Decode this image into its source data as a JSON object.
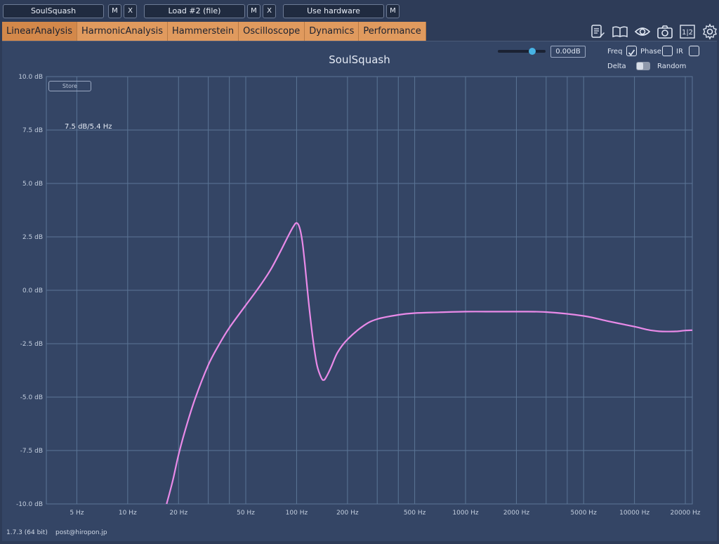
{
  "header": {
    "plugin_slot": "SoulSquash",
    "load_slot": "Load #2 (file)",
    "hardware_slot": "Use hardware",
    "m_label": "M",
    "x_label": "X"
  },
  "tabs": [
    "LinearAnalysis",
    "HarmonicAnalysis",
    "Hammerstein",
    "Oscilloscope",
    "Dynamics",
    "Performance"
  ],
  "toolbar_icons": [
    "notes-icon",
    "book-icon",
    "eye-icon",
    "camera-icon",
    "one-two-icon",
    "gear-icon"
  ],
  "one_two_label": "1|2",
  "plot": {
    "title": "SoulSquash",
    "gain_value": "0.00dB",
    "gain_level": 0.72,
    "freq_label": "Freq",
    "phase_label": "Phase",
    "ir_label": "IR",
    "delta_label": "Delta",
    "random_label": "Random",
    "freq_checked": true,
    "phase_checked": false,
    "ir_checked": false,
    "store_label": "Store",
    "cursor_readout": "7.5 dB/5.4 Hz"
  },
  "footer": {
    "version": "1.7.3 (64 bit)",
    "email": "post@hiropon.jp"
  },
  "colors": {
    "background": "#344565",
    "grid": "#5b7596",
    "curve": "#e98ae8",
    "tab": "#e09a5e"
  },
  "chart_data": {
    "type": "line",
    "title": "SoulSquash",
    "x_scale": "log",
    "xlim": [
      3.3,
      22000
    ],
    "ylim": [
      -10,
      10
    ],
    "y_ticks": [
      10,
      7.5,
      5,
      2.5,
      0,
      -2.5,
      -5,
      -7.5,
      -10
    ],
    "y_tick_labels": [
      "10.0 dB",
      "7.5 dB",
      "5.0 dB",
      "2.5 dB",
      "0.0 dB",
      "-2.5 dB",
      "-5.0 dB",
      "-7.5 dB",
      "-10.0 dB"
    ],
    "x_ticks": [
      5,
      10,
      20,
      50,
      100,
      200,
      500,
      1000,
      2000,
      5000,
      10000,
      20000
    ],
    "x_tick_labels": [
      "5 Hz",
      "10 Hz",
      "20 Hz",
      "50 Hz",
      "100 Hz",
      "200 Hz",
      "500 Hz",
      "1000 Hz",
      "2000 Hz",
      "5000 Hz",
      "10000 Hz",
      "20000 Hz"
    ],
    "x_minor_ticks": [
      30,
      40,
      300,
      400,
      3000,
      4000
    ],
    "grid": true,
    "series": [
      {
        "x": [
          17,
          18.5,
          20,
          22,
          25,
          30,
          35,
          40,
          50,
          60,
          70,
          80,
          90,
          96,
          100,
          104,
          108,
          112,
          118,
          125,
          132,
          140,
          145,
          150,
          160,
          175,
          200,
          250,
          300,
          400,
          500,
          700,
          1000,
          1500,
          2000,
          3000,
          5000,
          7000,
          10000,
          12000,
          14000,
          16000,
          18000,
          20000,
          22000
        ],
        "y": [
          -10,
          -8.9,
          -7.7,
          -6.5,
          -5.1,
          -3.5,
          -2.5,
          -1.75,
          -0.7,
          0.15,
          0.95,
          1.8,
          2.6,
          3.0,
          3.15,
          2.95,
          2.3,
          1.2,
          -0.6,
          -2.3,
          -3.5,
          -4.1,
          -4.2,
          -4.05,
          -3.6,
          -2.9,
          -2.3,
          -1.65,
          -1.35,
          -1.15,
          -1.07,
          -1.03,
          -1.0,
          -1.0,
          -1.0,
          -1.02,
          -1.2,
          -1.45,
          -1.7,
          -1.85,
          -1.92,
          -1.93,
          -1.92,
          -1.88,
          -1.87
        ]
      }
    ]
  }
}
